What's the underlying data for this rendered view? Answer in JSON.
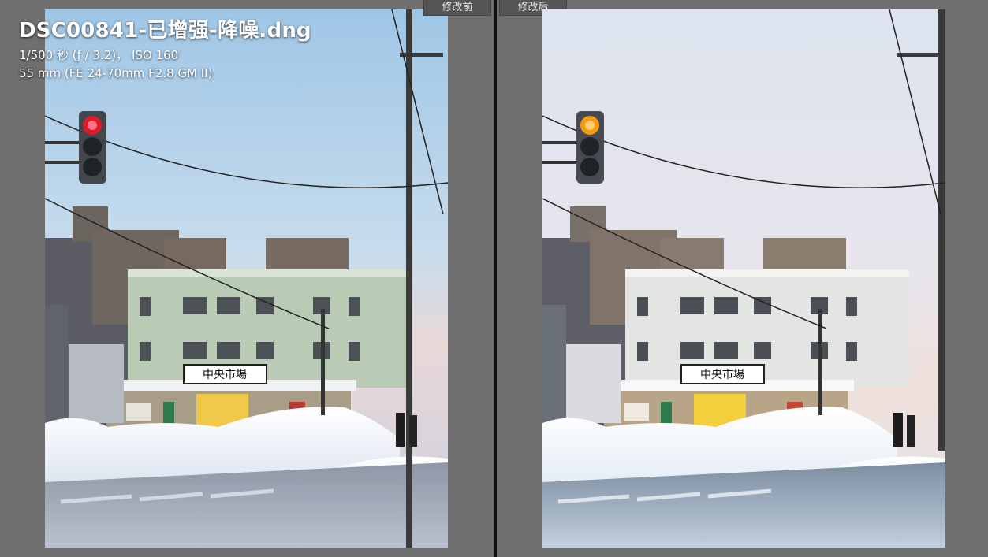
{
  "overlay": {
    "filename": "DSC00841-已增强-降噪.dng",
    "exposure": "1/500 秒 (ƒ / 3.2)， ISO 160",
    "lens": "55 mm (FE 24-70mm F2.8 GM II)"
  },
  "compare": {
    "before_label": "修改前",
    "after_label": "修改后"
  },
  "photo": {
    "store_sign_text": "中央市場"
  },
  "colors": {
    "background": "#6f6f6f",
    "divider": "#111111",
    "tab_bg": "#555555"
  }
}
